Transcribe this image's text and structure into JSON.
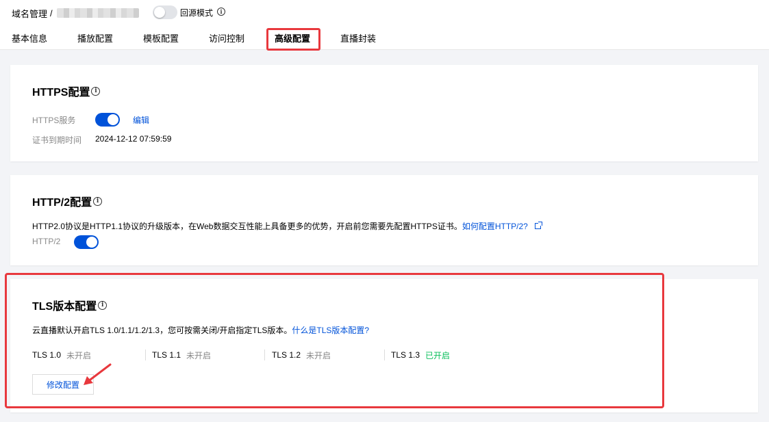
{
  "header": {
    "breadcrumb_root": "域名管理",
    "breadcrumb_sep": "/",
    "origin_mode_label": "回源模式"
  },
  "tabs": [
    {
      "label": "基本信息"
    },
    {
      "label": "播放配置"
    },
    {
      "label": "模板配置"
    },
    {
      "label": "访问控制"
    },
    {
      "label": "高级配置",
      "active": true
    },
    {
      "label": "直播封装"
    }
  ],
  "https": {
    "title": "HTTPS配置",
    "service_label": "HTTPS服务",
    "service_on": true,
    "edit_label": "编辑",
    "expiry_label": "证书到期时间",
    "expiry_value": "2024-12-12 07:59:59"
  },
  "http2": {
    "title": "HTTP/2配置",
    "desc": "HTTP2.0协议是HTTP1.1协议的升级版本，在Web数据交互性能上具备更多的优势，开启前您需要先配置HTTPS证书。",
    "link": "如何配置HTTP/2?",
    "toggle_label": "HTTP/2",
    "toggle_on": true
  },
  "tls": {
    "title": "TLS版本配置",
    "desc": "云直播默认开启TLS 1.0/1.1/1.2/1.3，您可按需关闭/开启指定TLS版本。",
    "link": "什么是TLS版本配置?",
    "versions": [
      {
        "version": "TLS 1.0",
        "status": "未开启"
      },
      {
        "version": "TLS 1.1",
        "status": "未开启"
      },
      {
        "version": "TLS 1.2",
        "status": "未开启"
      },
      {
        "version": "TLS 1.3",
        "status": "已开启"
      }
    ],
    "modify_label": "修改配置"
  },
  "colors": {
    "primary": "#0052d9",
    "enabled": "#0abf5b",
    "highlight": "#e8383d"
  }
}
